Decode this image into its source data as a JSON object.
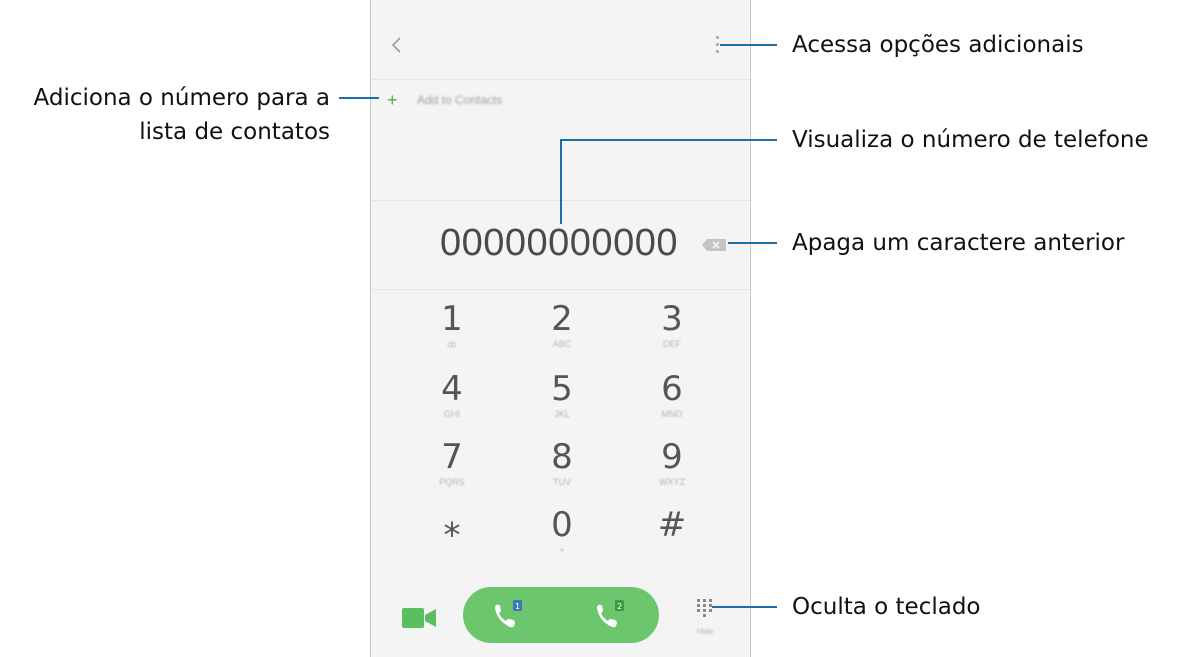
{
  "callouts": {
    "more_options": "Acessa opções adicionais",
    "add_to_contacts": [
      "Adiciona o número para a",
      "lista de contatos"
    ],
    "view_number": "Visualiza o número de telefone",
    "delete_char": "Apaga um caractere anterior",
    "hide_keypad": "Oculta o teclado"
  },
  "dialer": {
    "add_contacts_label": "Add to Contacts",
    "number": "00000000000",
    "keys": [
      {
        "digit": "1",
        "sub": "ꝏ"
      },
      {
        "digit": "2",
        "sub": "ABC"
      },
      {
        "digit": "3",
        "sub": "DEF"
      },
      {
        "digit": "4",
        "sub": "GHI"
      },
      {
        "digit": "5",
        "sub": "JKL"
      },
      {
        "digit": "6",
        "sub": "MNO"
      },
      {
        "digit": "7",
        "sub": "PQRS"
      },
      {
        "digit": "8",
        "sub": "TUV"
      },
      {
        "digit": "9",
        "sub": "WXYZ"
      },
      {
        "digit": "⁎",
        "sub": ""
      },
      {
        "digit": "0",
        "sub": "+"
      },
      {
        "digit": "#",
        "sub": ""
      }
    ],
    "sim1_label": "1",
    "sim2_label": "2",
    "keypad_sub": "Hide"
  },
  "colors": {
    "accent_green": "#6cc66e",
    "callout_line": "#1f6ea8"
  }
}
